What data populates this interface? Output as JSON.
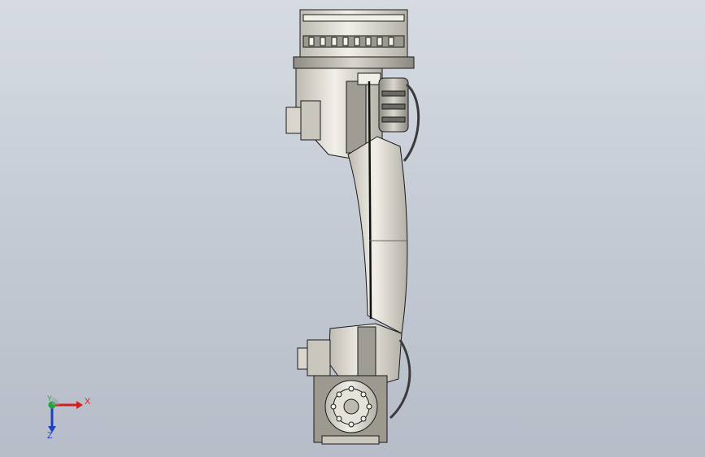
{
  "viewport": {
    "background_top": "#d6dbe3",
    "background_bottom": "#b7bdc8"
  },
  "model": {
    "name": "robot-arm",
    "shade_color": "#e8e6dc",
    "line_color": "#1a1a1a"
  },
  "triad": {
    "x_label": "X",
    "y_label": "Y",
    "z_label": "Z",
    "x_color": "#d21e1e",
    "y_color": "#1fa43a",
    "z_color": "#1d3fc4"
  }
}
